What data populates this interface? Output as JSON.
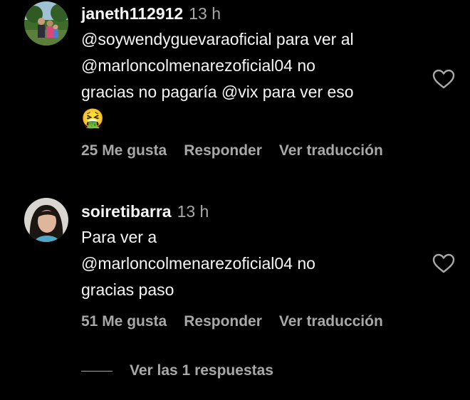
{
  "comments": [
    {
      "username": "janeth112912",
      "time": "13 h",
      "lines": [
        "@soywendyguevaraoficial para ver al",
        "@marloncolmenarezoficial04 no",
        "gracias no pagaría @vix para ver eso"
      ],
      "emoji": "🤮",
      "likes": "25 Me gusta",
      "reply_label": "Responder",
      "translate_label": "Ver traducción",
      "icon": "heart-outline"
    },
    {
      "username": "soiretibarra",
      "time": "13 h",
      "lines": [
        "Para ver a",
        "@marloncolmenarezoficial04 no",
        "gracias paso"
      ],
      "likes": "51 Me gusta",
      "reply_label": "Responder",
      "translate_label": "Ver traducción",
      "icon": "heart-outline"
    }
  ],
  "view_replies": "Ver las 1 respuestas",
  "colors": {
    "background": "#000000",
    "text": "#f5f5f5",
    "secondary": "#a8a8a8"
  }
}
